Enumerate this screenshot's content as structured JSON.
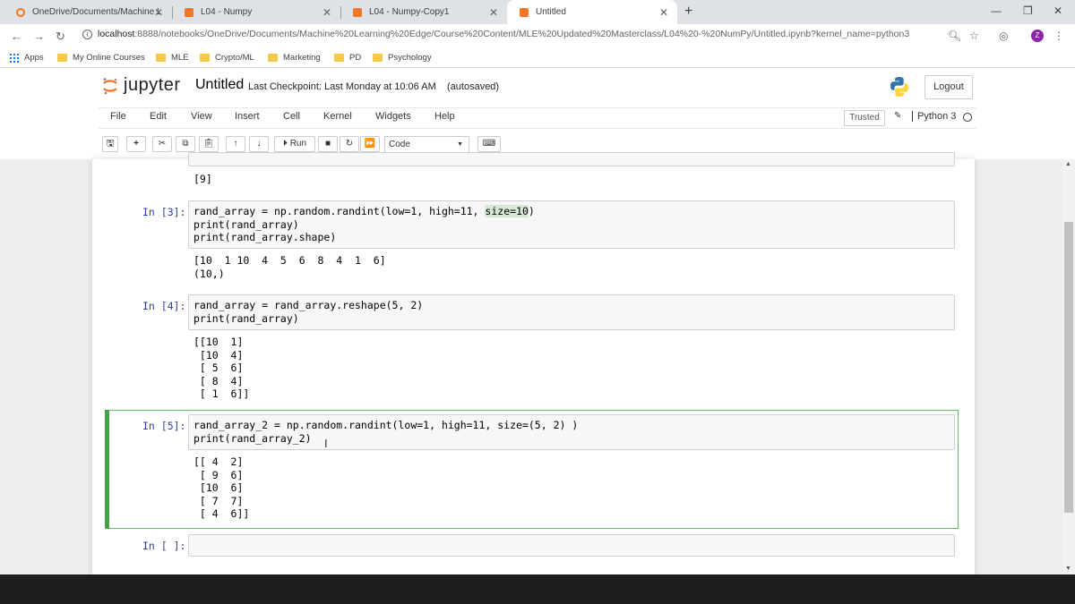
{
  "browser": {
    "tabs": [
      {
        "title": "OneDrive/Documents/Machine L",
        "favicon_color": "#f37626"
      },
      {
        "title": "L04 - Numpy",
        "favicon_color": "#f37626"
      },
      {
        "title": "L04 - Numpy-Copy1",
        "favicon_color": "#f37626"
      },
      {
        "title": "Untitled",
        "favicon_color": "#f37626"
      }
    ],
    "url_host": "localhost",
    "url_path": ":8888/notebooks/OneDrive/Documents/Machine%20Learning%20Edge/Course%20Content/MLE%20Updated%20Masterclass/L04%20-%20NumPy/Untitled.ipynb?kernel_name=python3",
    "profile_initial": "Z",
    "bookmarks": [
      "Apps",
      "My Online Courses",
      "MLE",
      "Crypto/ML",
      "Marketing",
      "PD",
      "Psychology"
    ]
  },
  "jupyter": {
    "wordmark": "jupyter",
    "notebook_title": "Untitled",
    "checkpoint": "Last Checkpoint: Last Monday at 10:06 AM",
    "autosave": "(autosaved)",
    "logout_label": "Logout",
    "menu": [
      "File",
      "Edit",
      "View",
      "Insert",
      "Cell",
      "Kernel",
      "Widgets",
      "Help"
    ],
    "trusted_label": "Trusted",
    "kernel_label": "Python 3",
    "run_label": "Run",
    "cell_type": "Code"
  },
  "cells": {
    "c2": {
      "output": "[9]"
    },
    "c3": {
      "prompt": "In [3]:",
      "code_l1a": "rand_array = np.random.randint(low=1, high=11, ",
      "code_l1b": "size=10",
      "code_l1c": ")",
      "code_l2": "print(rand_array)",
      "code_l3": "print(rand_array.shape)",
      "output": "[10  1 10  4  5  6  8  4  1  6]\n(10,)"
    },
    "c4": {
      "prompt": "In [4]:",
      "code": "rand_array = rand_array.reshape(5, 2)\nprint(rand_array)",
      "output": "[[10  1]\n [10  4]\n [ 5  6]\n [ 8  4]\n [ 1  6]]"
    },
    "c5": {
      "prompt": "In [5]:",
      "code": "rand_array_2 = np.random.randint(low=1, high=11, size=(5, 2) )\nprint(rand_array_2)",
      "output": "[[ 4  2]\n [ 9  6]\n [10  6]\n [ 7  7]\n [ 4  6]]"
    },
    "c6": {
      "prompt": "In [ ]:"
    }
  }
}
